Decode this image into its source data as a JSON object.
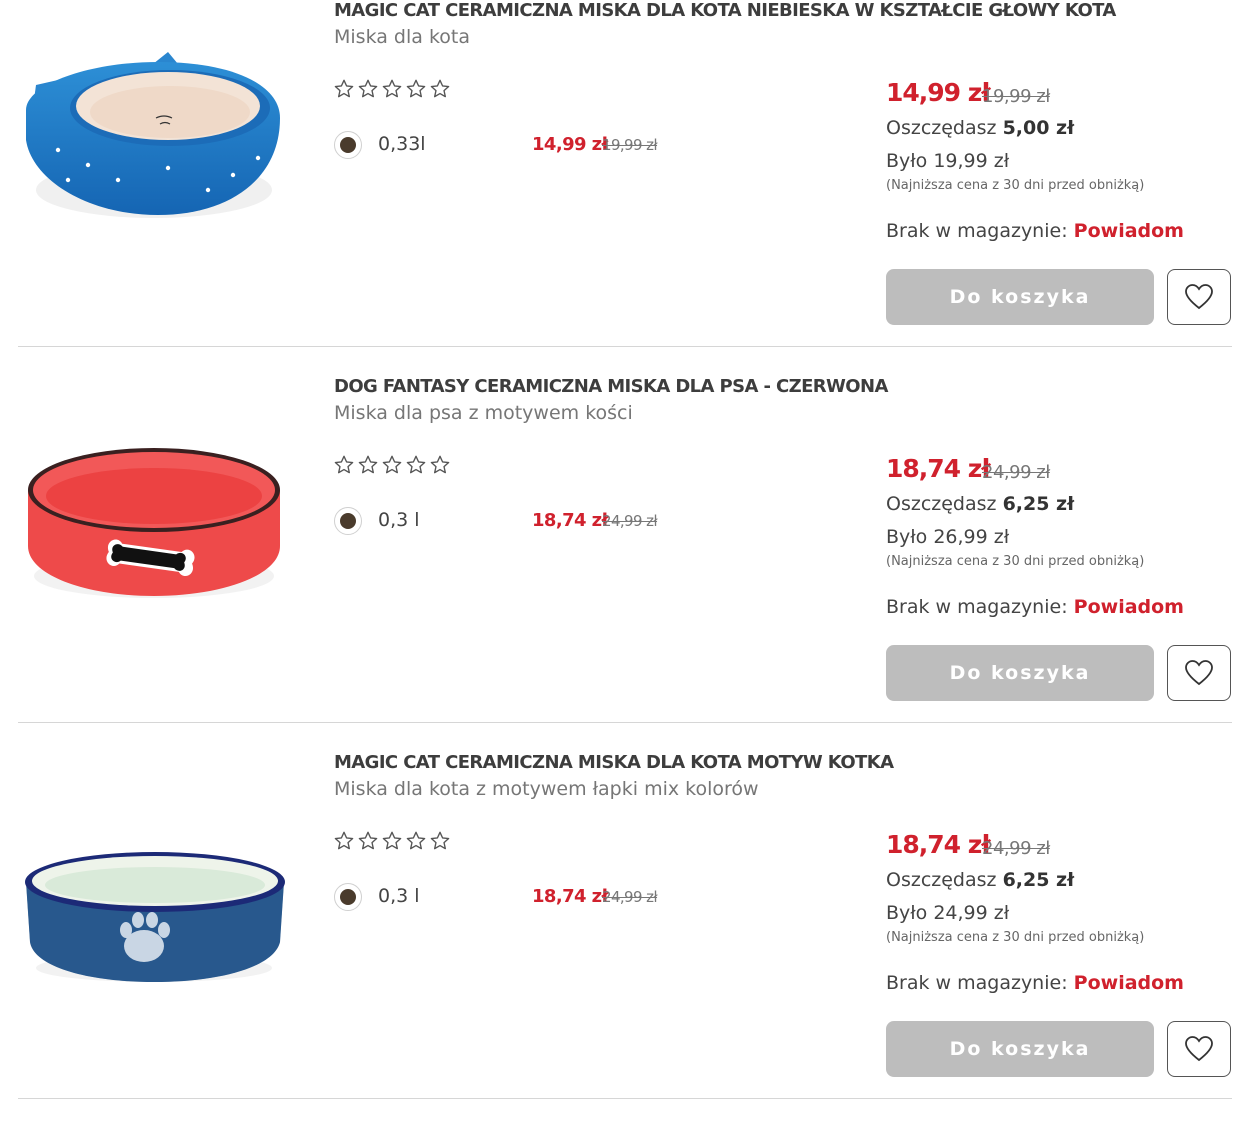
{
  "products": [
    {
      "title": "MAGIC CAT CERAMICZNA MISKA DLA KOTA NIEBIESKA W KSZTAŁCIE GŁOWY KOTA",
      "subtitle": "Miska dla kota",
      "rating_stars": 0,
      "rating_max": 5,
      "variant": {
        "label": "0,33l",
        "price": "14,99 zł",
        "old_price": "19,99 zł",
        "color": "#4a3b2c"
      },
      "price": "14,99 zł",
      "old_price": "19,99 zł",
      "savings_label": "Oszczędasz",
      "savings_value": "5,00 zł",
      "was": "Było 19,99 zł",
      "lowest_note": "(Najniższa cena z 30 dni przed obniżką)",
      "stock_label": "Brak w magazynie:",
      "stock_action": "Powiadom",
      "cart_label": "Do koszyka",
      "image_icon": "blue-cat-head-bowl"
    },
    {
      "title": "DOG FANTASY CERAMICZNA MISKA DLA PSA - CZERWONA",
      "subtitle": "Miska dla psa z motywem kości",
      "rating_stars": 0,
      "rating_max": 5,
      "variant": {
        "label": "0,3 l",
        "price": "18,74 zł",
        "old_price": "24,99 zł",
        "color": "#4a3b2c"
      },
      "price": "18,74 zł",
      "old_price": "24,99 zł",
      "savings_label": "Oszczędasz",
      "savings_value": "6,25 zł",
      "was": "Było 26,99 zł",
      "lowest_note": "(Najniższa cena z 30 dni przed obniżką)",
      "stock_label": "Brak w magazynie:",
      "stock_action": "Powiadom",
      "cart_label": "Do koszyka",
      "image_icon": "red-bone-bowl"
    },
    {
      "title": "MAGIC CAT CERAMICZNA MISKA DLA KOTA MOTYW KOTKA",
      "subtitle": "Miska dla kota z motywem łapki mix kolorów",
      "rating_stars": 0,
      "rating_max": 5,
      "variant": {
        "label": "0,3 l",
        "price": "18,74 zł",
        "old_price": "24,99 zł",
        "color": "#4a3b2c"
      },
      "price": "18,74 zł",
      "old_price": "24,99 zł",
      "savings_label": "Oszczędasz",
      "savings_value": "6,25 zł",
      "was": "Było 24,99 zł",
      "lowest_note": "(Najniższa cena z 30 dni przed obniżką)",
      "stock_label": "Brak w magazynie:",
      "stock_action": "Powiadom",
      "cart_label": "Do koszyka",
      "image_icon": "blue-paw-bowl"
    }
  ],
  "colors": {
    "accent_red": "#d0212d",
    "button_disabled": "#bdbdbd",
    "divider": "#d6d6d6"
  }
}
